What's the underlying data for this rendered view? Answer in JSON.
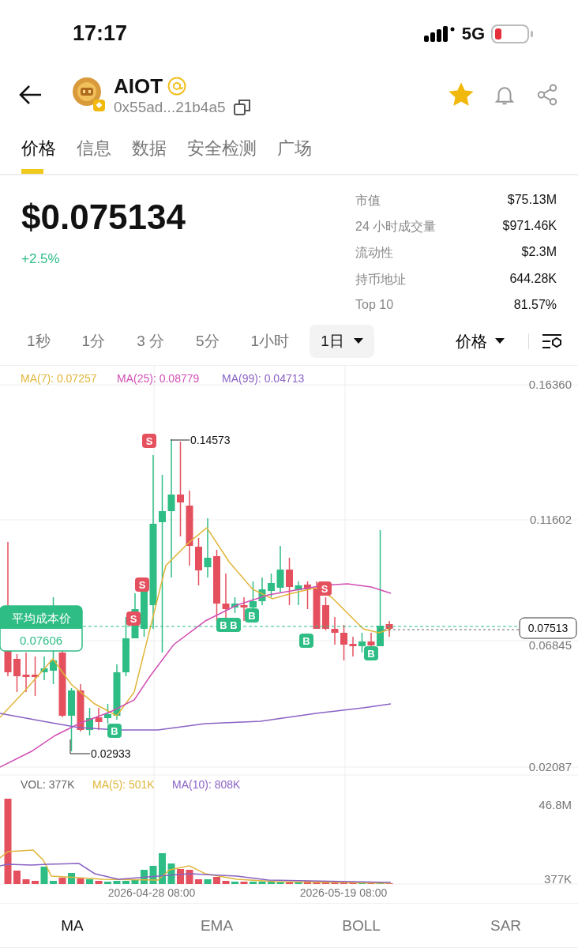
{
  "status_bar": {
    "time": "17:17",
    "network": "5G"
  },
  "token": {
    "name": "AIOT",
    "address": "0x55ad...21b4a5",
    "favorited": true
  },
  "tabs": [
    {
      "label": "价格",
      "selected": true
    },
    {
      "label": "信息",
      "selected": false
    },
    {
      "label": "数据",
      "selected": false
    },
    {
      "label": "安全检测",
      "selected": false
    },
    {
      "label": "广场",
      "selected": false
    }
  ],
  "price": {
    "value": "$0.075134",
    "change": "+2.5%"
  },
  "stats": [
    {
      "label": "市值",
      "value": "$75.13M"
    },
    {
      "label": "24 小时成交量",
      "value": "$971.46K"
    },
    {
      "label": "流动性",
      "value": "$2.3M"
    },
    {
      "label": "持币地址",
      "value": "644.28K"
    },
    {
      "label": "Top 10",
      "value": "81.57%"
    }
  ],
  "intervals": [
    {
      "label": "1秒",
      "selected": false
    },
    {
      "label": "1分",
      "selected": false
    },
    {
      "label": "3 分",
      "selected": false
    },
    {
      "label": "5分",
      "selected": false
    },
    {
      "label": "1小时",
      "selected": false
    },
    {
      "label": "1日",
      "selected": true
    }
  ],
  "price_type": "价格",
  "chart": {
    "legend": [
      {
        "label": "MA(7): 0.07257",
        "color": "#e0b53a"
      },
      {
        "label": "MA(25): 0.08779",
        "color": "#d14fb4"
      },
      {
        "label": "MA(99): 0.04713",
        "color": "#8a62c4"
      }
    ],
    "y_labels": [
      "0.16360",
      "0.11602",
      "0.06845",
      "0.02087"
    ],
    "high_label": "0.14573",
    "low_label": "0.02933",
    "avg_cost": {
      "title": "平均成本价",
      "value": "0.07606"
    },
    "current_price": "0.07513",
    "signals": [
      {
        "kind": "sell",
        "label": "S"
      },
      {
        "kind": "sell",
        "label": "S"
      },
      {
        "kind": "sell",
        "label": "S"
      },
      {
        "kind": "sell",
        "label": "S"
      },
      {
        "kind": "buy",
        "label": "B"
      },
      {
        "kind": "buy",
        "label": "B"
      },
      {
        "kind": "buy",
        "label": "B"
      },
      {
        "kind": "buy",
        "label": "B"
      },
      {
        "kind": "buy",
        "label": "B"
      },
      {
        "kind": "buy",
        "label": "B"
      }
    ]
  },
  "volume": {
    "legend": [
      {
        "label": "VOL: 377K",
        "color": "#666666"
      },
      {
        "label": "MA(5): 501K",
        "color": "#e0b53a"
      },
      {
        "label": "MA(10): 808K",
        "color": "#8a62c4"
      }
    ],
    "y_labels": [
      "46.8M",
      "377K"
    ],
    "x_labels": [
      "2026-04-28 08:00",
      "2026-05-19 08:00"
    ]
  },
  "indicator_tabs": [
    {
      "label": "MA",
      "selected": true
    },
    {
      "label": "EMA",
      "selected": false
    },
    {
      "label": "BOLL",
      "selected": false
    },
    {
      "label": "SAR",
      "selected": false
    }
  ]
}
